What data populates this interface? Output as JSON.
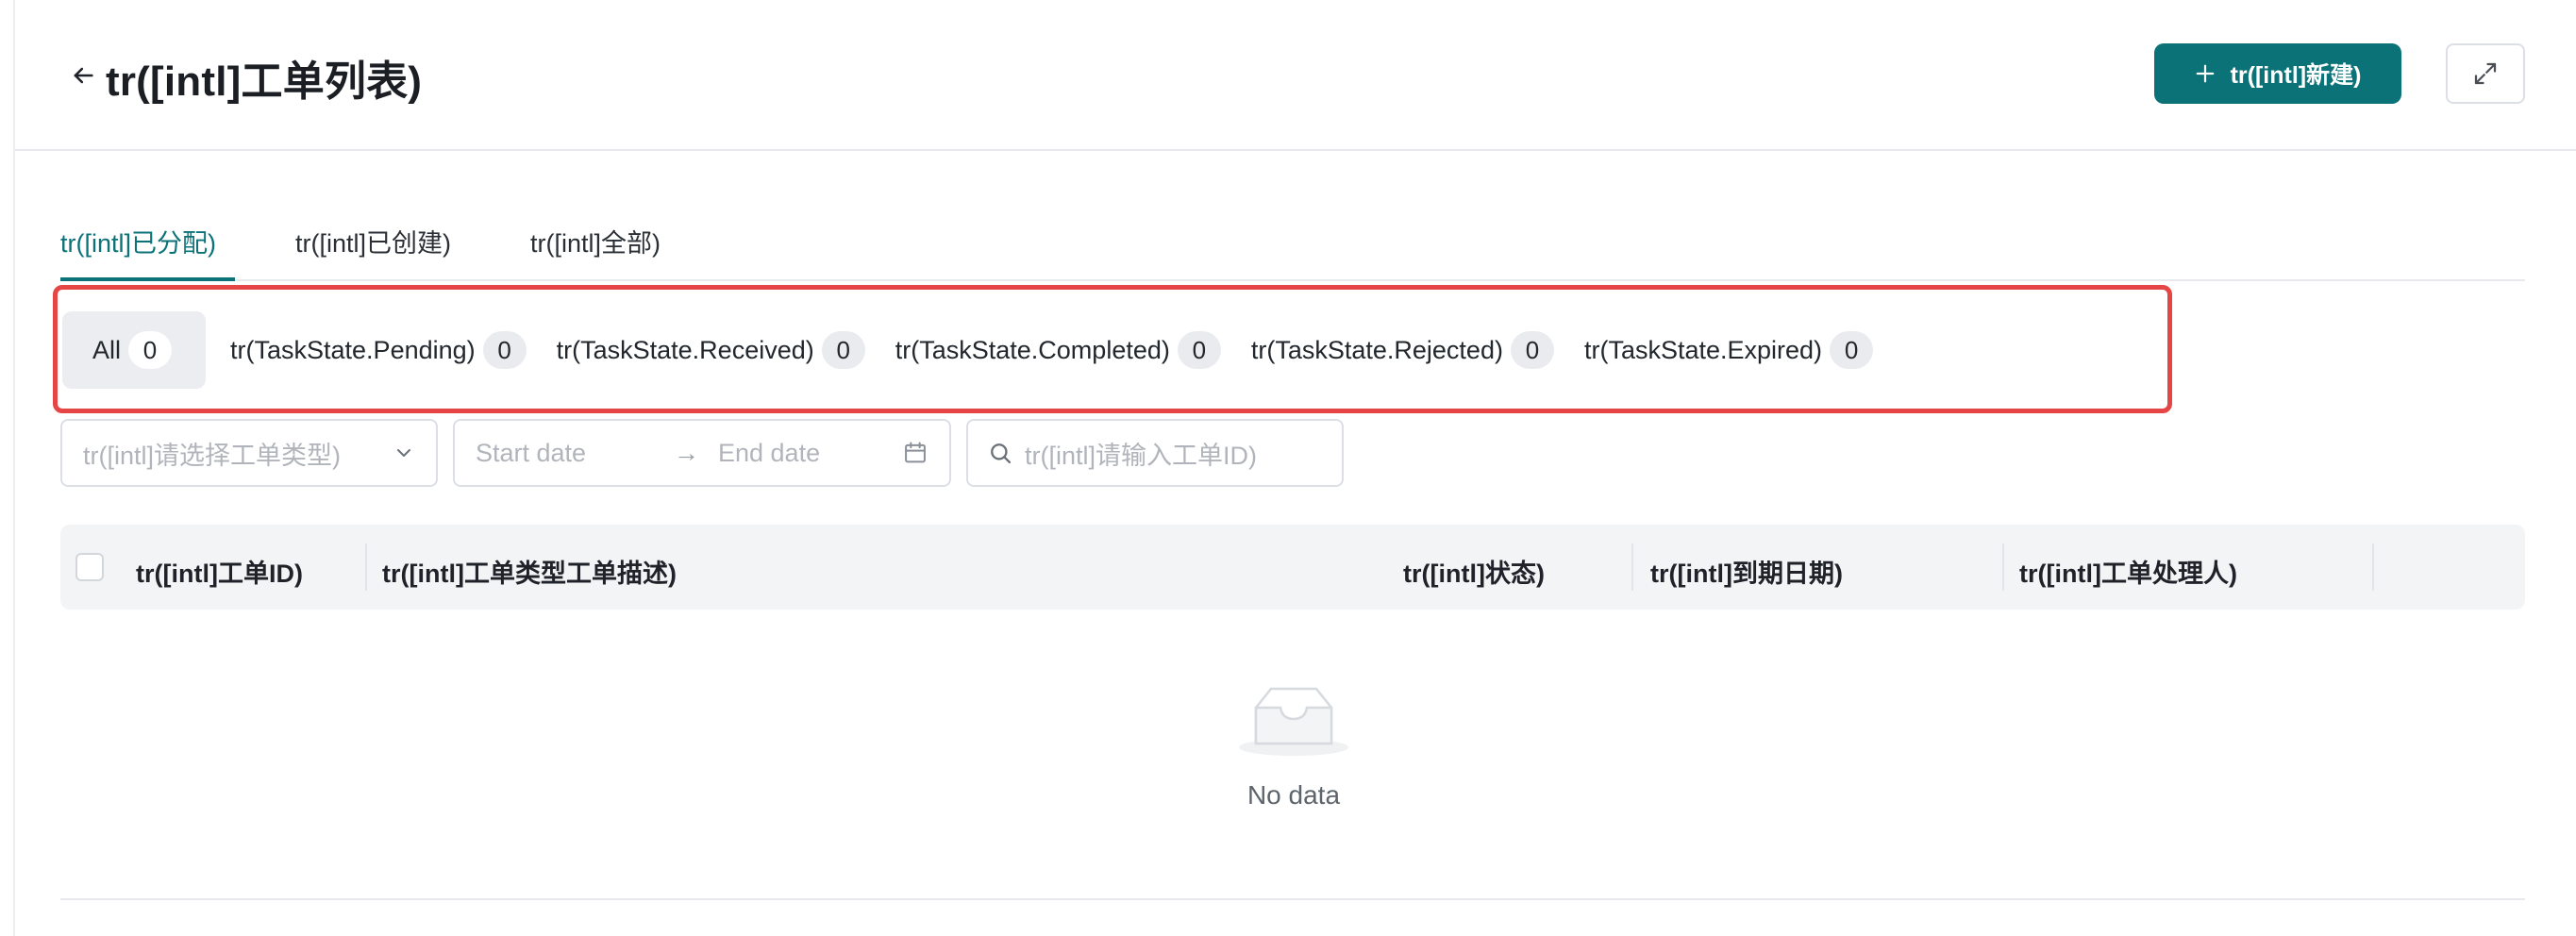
{
  "header": {
    "title": "tr([intl]工单列表)",
    "new_button": "tr([intl]新建)"
  },
  "tabs": [
    {
      "label": "tr([intl]已分配)",
      "active": true
    },
    {
      "label": "tr([intl]已创建)",
      "active": false
    },
    {
      "label": "tr([intl]全部)",
      "active": false
    }
  ],
  "states": [
    {
      "label": "All",
      "count": "0",
      "active": true
    },
    {
      "label": "tr(TaskState.Pending)",
      "count": "0"
    },
    {
      "label": "tr(TaskState.Received)",
      "count": "0"
    },
    {
      "label": "tr(TaskState.Completed)",
      "count": "0"
    },
    {
      "label": "tr(TaskState.Rejected)",
      "count": "0"
    },
    {
      "label": "tr(TaskState.Expired)",
      "count": "0"
    }
  ],
  "filters": {
    "type_placeholder": "tr([intl]请选择工单类型)",
    "start_placeholder": "Start date",
    "date_separator": "→",
    "end_placeholder": "End date",
    "search_placeholder": "tr([intl]请输入工单ID)"
  },
  "table": {
    "columns": [
      "tr([intl]工单ID)",
      "tr([intl]工单类型工单描述)",
      "tr([intl]状态)",
      "tr([intl]到期日期)",
      "tr([intl]工单处理人)"
    ],
    "empty_text": "No data"
  },
  "colors": {
    "accent": "#0b7278",
    "highlight": "#e64545"
  },
  "icons": [
    "arrow-left-icon",
    "plus-icon",
    "expand-icon",
    "chevron-down-icon",
    "calendar-icon",
    "search-icon",
    "empty-inbox-icon"
  ]
}
